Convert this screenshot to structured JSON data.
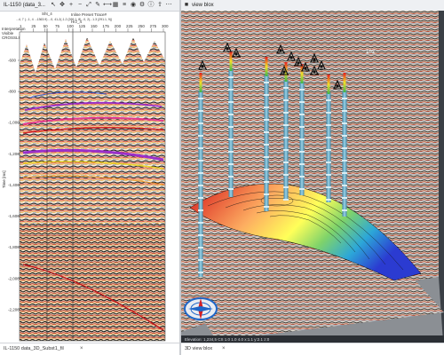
{
  "left": {
    "title": "IL-1150 (data_3...",
    "header_line1": "Inline Preset Trace#",
    "header_line2": "...4, 7 (...1, 4 ...1363.9)    ...0, 41-2(-1.2 (269.1, 8)...0, 2(...1.3 (291.1, 9))",
    "marker_a": "Sht_4",
    "marker_b": "Hrz_4",
    "side_label1": "Interpretation",
    "side_label2": "Visible",
    "side_label3": "CROSSLINE",
    "ylabel": "Time [ms]",
    "xticks": [
      "1",
      "25",
      "50",
      "75",
      "100",
      "125",
      "150",
      "175",
      "200",
      "225",
      "250",
      "275",
      "300"
    ],
    "yticks": [
      "-600",
      "-800",
      "-1,000",
      "-1,200",
      "-1,400",
      "-1,600",
      "-1,800",
      "-2,000",
      "-2,200"
    ],
    "tab_label": "IL-1150 data_3D_Subst1_fil"
  },
  "right": {
    "title": "view blox",
    "number_label": "102",
    "status_text": "Elevation: 1,234,5 CS 1.0 1.0 4.0   x:1.1 y:2.1 z:0",
    "tab_label": "3D view blox"
  },
  "colors": {
    "accent_blue": "#1e66c8",
    "horizon_purple": "#9b2fc9",
    "horizon_yellow": "#e8d12a",
    "surface_red": "#d7191c"
  },
  "icons": [
    "zoom-in-icon",
    "zoom-out-icon",
    "pan-icon",
    "settings-icon",
    "grid-icon",
    "well-icon",
    "compass-icon",
    "close-icon"
  ]
}
